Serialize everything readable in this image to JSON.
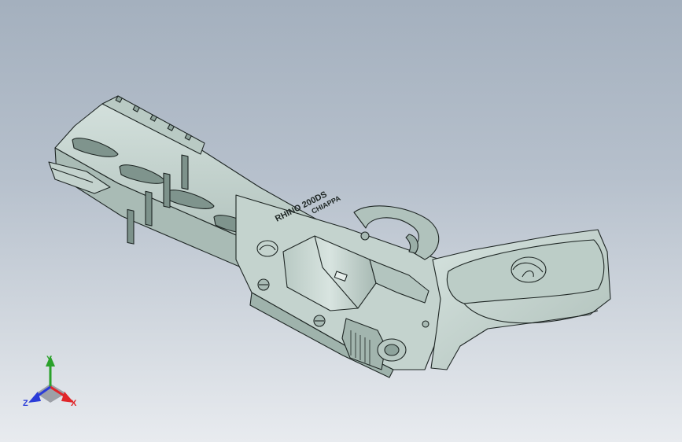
{
  "viewport": {
    "background_top": "#a4b0be",
    "background_bottom": "#e8ebef"
  },
  "model": {
    "name": "revolver-model",
    "body_color": "#c9d8d3",
    "shade_color": "#9fb3ac",
    "edge_color": "#1e2624",
    "engravings": {
      "line_1": "RHINO 200DS",
      "line_2": "CHIAPPA"
    },
    "logo_icon": "rhino-logo-icon"
  },
  "triad": {
    "x_label": "X",
    "y_label": "Y",
    "z_label": "Z",
    "x_color": "#e0262a",
    "y_color": "#2aa12a",
    "z_color": "#2a3cd8"
  }
}
